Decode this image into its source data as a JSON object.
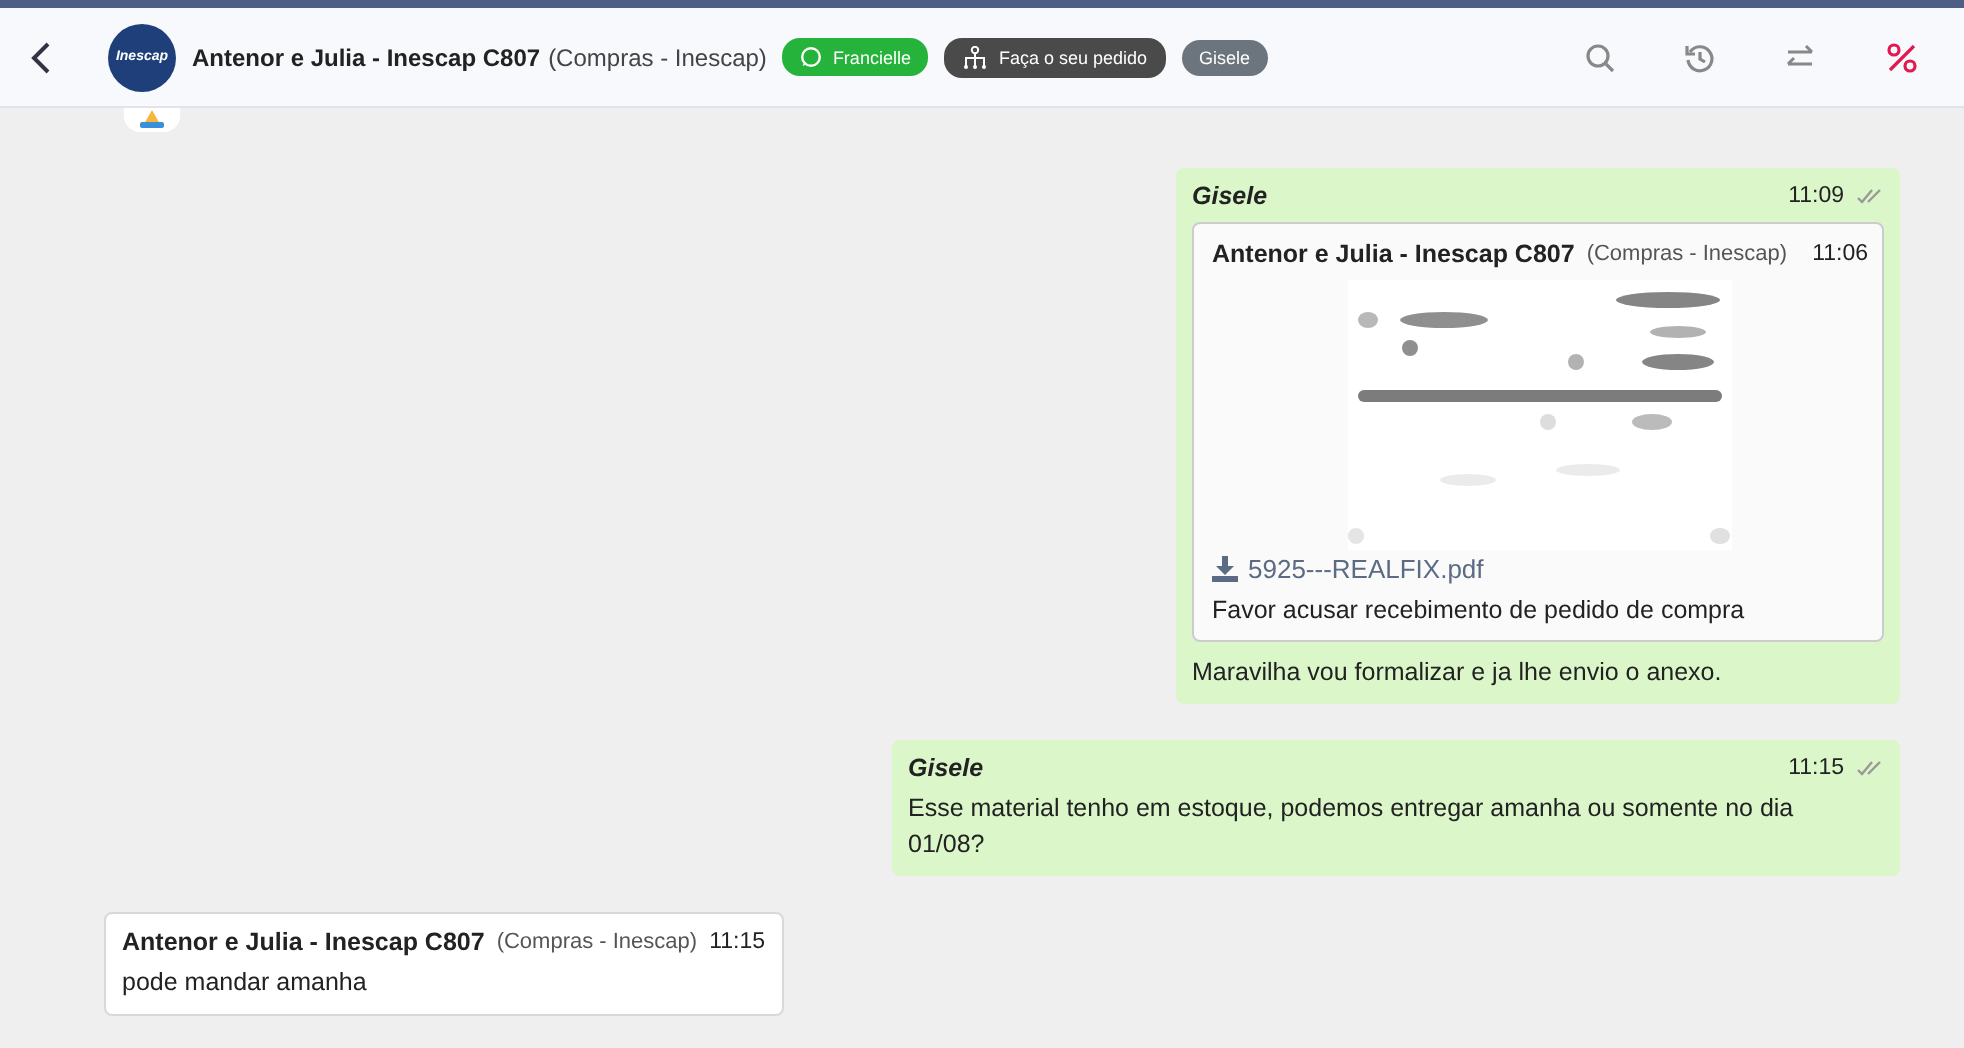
{
  "header": {
    "logo_text": "Inescap",
    "title": "Antenor e Julia - Inescap C807",
    "subtitle": "(Compras - Inescap)",
    "tags": [
      {
        "kind": "whatsapp",
        "label": "Francielle",
        "color": "#25b33b"
      },
      {
        "kind": "org",
        "label": "Faça o seu pedido",
        "color": "#4a4a4a"
      },
      {
        "kind": "plain",
        "label": "Gisele",
        "color": "#6c757d"
      }
    ]
  },
  "messages": [
    {
      "kind": "out",
      "author": "Gisele",
      "time": "11:09",
      "read": true,
      "quote": {
        "author": "Antenor e Julia - Inescap C807",
        "subtitle": "(Compras - Inescap)",
        "time": "11:06",
        "attachment": {
          "kind": "picture",
          "file": "5925---REALFIX.pdf"
        },
        "text": "Favor acusar recebimento de pedido de compra"
      },
      "text": "Maravilha vou formalizar e ja lhe envio o anexo."
    },
    {
      "kind": "out",
      "author": "Gisele",
      "time": "11:15",
      "read": true,
      "text": "Esse material tenho em estoque, podemos entregar amanha ou somente no dia 01/08?"
    },
    {
      "kind": "in",
      "author": "Antenor e Julia - Inescap C807",
      "subtitle": "(Compras - Inescap)",
      "time": "11:15",
      "text": "pode mandar amanha"
    }
  ]
}
